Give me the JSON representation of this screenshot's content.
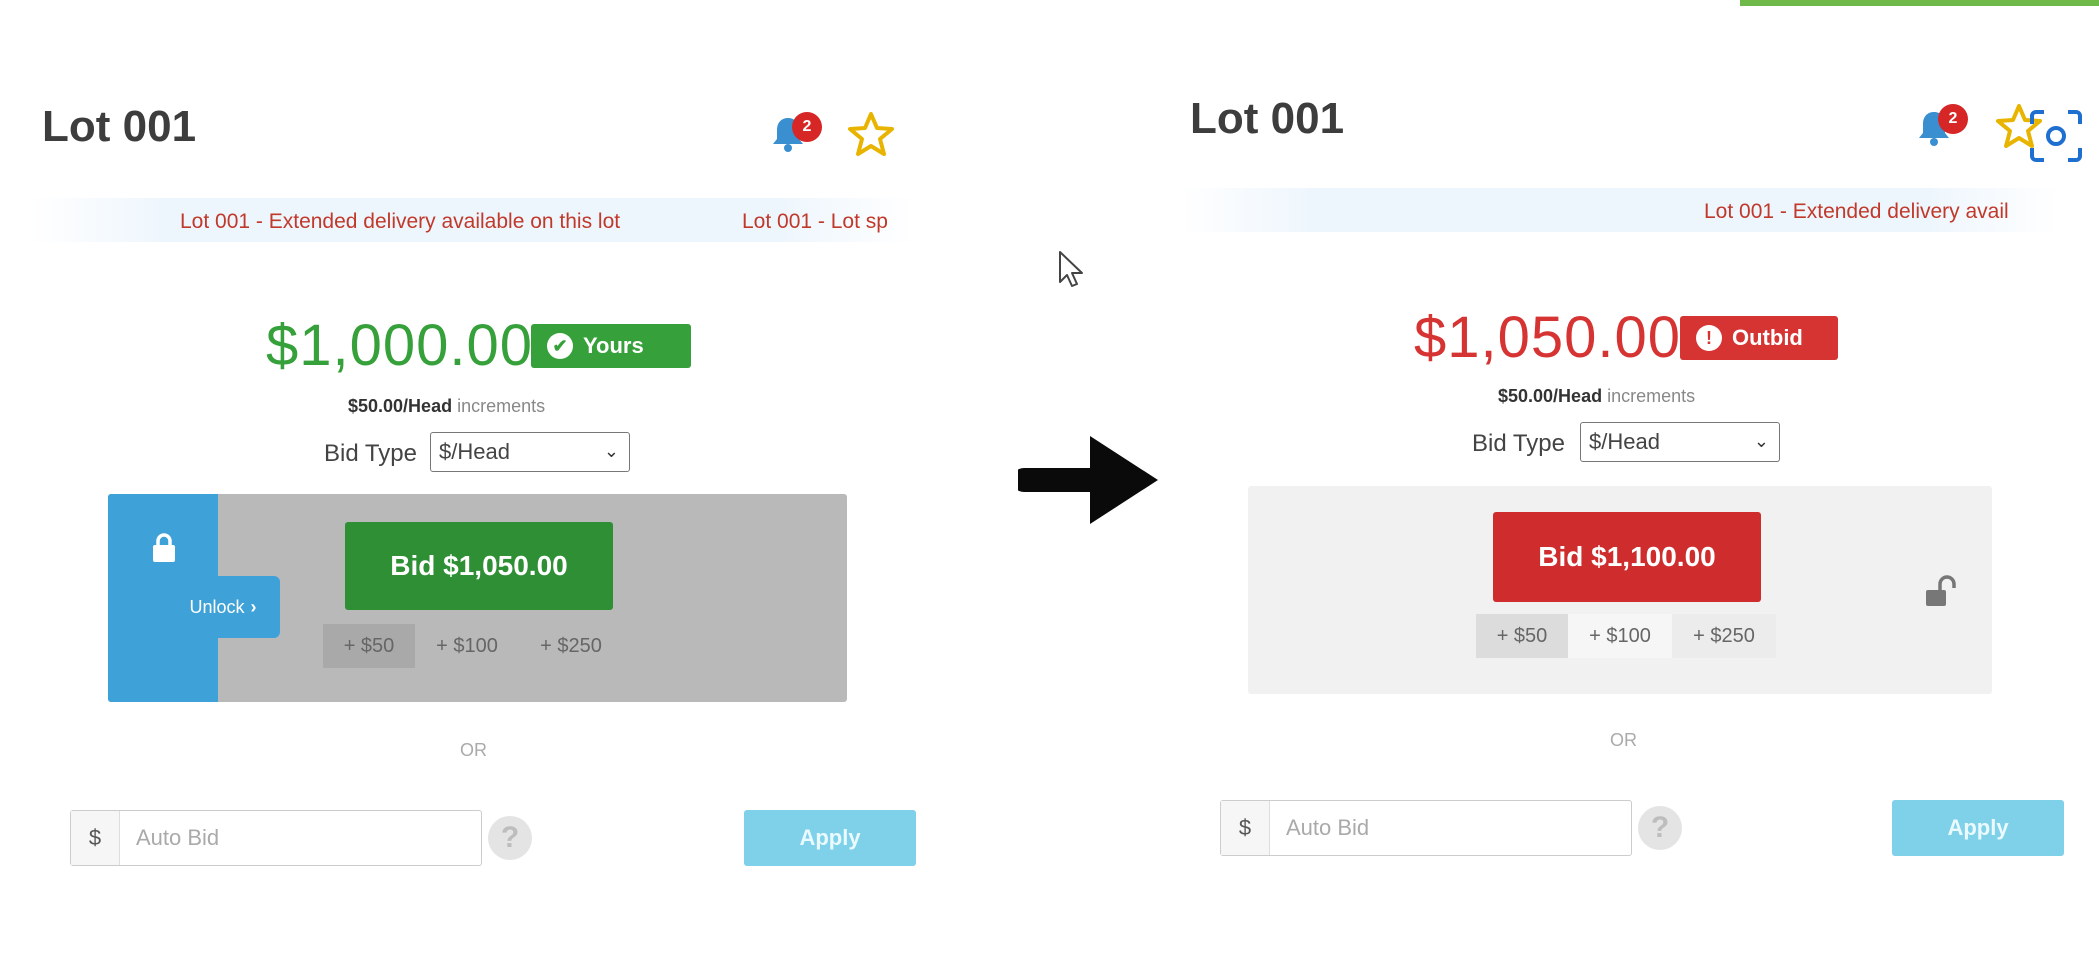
{
  "colors": {
    "yours_green": "#36a03a",
    "bid_green": "#2f8f34",
    "outbid_red": "#d63333",
    "bid_red": "#cf2d2d",
    "unlock_blue": "#3ea2d8",
    "apply_blue": "#7fd1ea",
    "ticker_red": "#c0392b"
  },
  "icons": {
    "bell": "bell-icon",
    "star": "star-icon",
    "focus": "screenshot-focus-icon",
    "lock": "lock-icon",
    "unlock": "unlocked-padlock-icon",
    "arrow": "right-arrow-icon",
    "cursor": "mouse-cursor-icon",
    "help": "help-icon"
  },
  "before": {
    "lot_title": "Lot 001",
    "notification_count": "2",
    "ticker": [
      "Lot 001 - Extended delivery available on this lot",
      "Lot 001 - Lot sp"
    ],
    "price": "$1,000.00",
    "status": "Yours",
    "status_icon": "✔",
    "increment_amount": "$50.00/Head",
    "increment_suffix": " increments",
    "bid_type_label": "Bid Type",
    "bid_type_value": "$/Head",
    "unlock_label": "Unlock",
    "bid_button": "Bid $1,050.00",
    "increments": [
      "+ $50",
      "+ $100",
      "+ $250"
    ],
    "or": "OR",
    "currency": "$",
    "autobid_placeholder": "Auto Bid",
    "apply": "Apply"
  },
  "after": {
    "lot_title": "Lot 001",
    "notification_count": "2",
    "ticker": [
      "Lot 001 - Extended delivery avail"
    ],
    "price": "$1,050.00",
    "status": "Outbid",
    "status_icon": "!",
    "increment_amount": "$50.00/Head",
    "increment_suffix": " increments",
    "bid_type_label": "Bid Type",
    "bid_type_value": "$/Head",
    "bid_button": "Bid $1,100.00",
    "increments": [
      "+ $50",
      "+ $100",
      "+ $250"
    ],
    "or": "OR",
    "currency": "$",
    "autobid_placeholder": "Auto Bid",
    "apply": "Apply"
  }
}
